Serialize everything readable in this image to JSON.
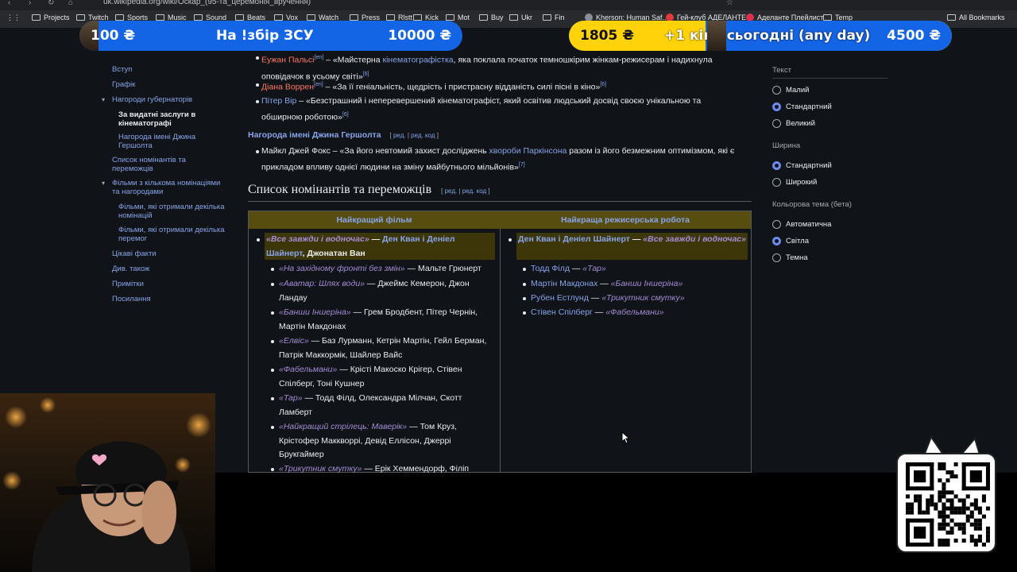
{
  "browser": {
    "url": "uk.wikipedia.org/wiki/Оскар_(95-та_церемонія_вручення)",
    "bookmarks": [
      {
        "label": "Projects",
        "type": "folder"
      },
      {
        "label": "Twitch",
        "type": "folder"
      },
      {
        "label": "Sports",
        "type": "folder"
      },
      {
        "label": "Music",
        "type": "folder"
      },
      {
        "label": "Sound",
        "type": "folder"
      },
      {
        "label": "Beats",
        "type": "folder"
      },
      {
        "label": "Vox",
        "type": "folder"
      },
      {
        "label": "Watch",
        "type": "folder"
      },
      {
        "label": "Press",
        "type": "folder"
      },
      {
        "label": "Rlstt",
        "type": "folder"
      },
      {
        "label": "Kick",
        "type": "folder"
      },
      {
        "label": "Mot",
        "type": "folder"
      },
      {
        "label": "Buy",
        "type": "folder"
      },
      {
        "label": "Ukr",
        "type": "folder"
      },
      {
        "label": "Fin",
        "type": "folder"
      },
      {
        "label": "Kherson: Human Saf...",
        "type": "site"
      },
      {
        "label": "Гей-клуб АДЕЛАНТЕ",
        "type": "site"
      },
      {
        "label": "Аделанте Плейлист",
        "type": "site"
      },
      {
        "label": "Temp",
        "type": "folder"
      }
    ],
    "all_bookmarks": "All Bookmarks"
  },
  "overlay": {
    "banner_left": {
      "left": "100 ₴",
      "center": "На !збір ЗСУ",
      "right": "10000 ₴"
    },
    "banner_right": {
      "left": "1805 ₴",
      "center": "+1 кіно сьогодні (any day)",
      "right": "4500 ₴"
    },
    "accent_blue": "#1464e6",
    "accent_yellow": "#ffd20a"
  },
  "toc": {
    "items": [
      {
        "label": "Вступ",
        "level": 1
      },
      {
        "label": "Графік",
        "level": 1
      },
      {
        "label": "Нагороди губернаторів",
        "level": 1,
        "expanded": true
      },
      {
        "label": "За видатні заслуги в кінематографі",
        "level": 2,
        "active": true
      },
      {
        "label": "Нагорода імені Джина Гершолта",
        "level": 2
      },
      {
        "label": "Список номінантів та переможців",
        "level": 1
      },
      {
        "label": "Фільми з кількома номінаціями та нагородами",
        "level": 1,
        "expanded": true
      },
      {
        "label": "Фільми, які отримали декілька номінацій",
        "level": 2
      },
      {
        "label": "Фільми, які отримали декілька перемог",
        "level": 2
      },
      {
        "label": "Цікаві факти",
        "level": 1
      },
      {
        "label": "Див. також",
        "level": 1
      },
      {
        "label": "Примітки",
        "level": 1
      },
      {
        "label": "Посилання",
        "level": 1
      }
    ]
  },
  "article": {
    "honorees": [
      {
        "name": "Еужан Пальсі",
        "sup": "[en]",
        "quote": " – «Майстерна ",
        "link": "кінематографістка",
        "rest": ", яка поклала початок темношкірим жінкам-режисерам і надихнула оповідачок в усьому світі»",
        "ref": "[6]"
      },
      {
        "name": "Діана Воррен",
        "sup": "[en]",
        "quote": " – «За її геніальність, щедрість і пристрасну відданість силі пісні в кіно»",
        "ref": "[6]"
      },
      {
        "name": "Пітер Вір",
        "quote": " – «Безстрашний і неперевершений кінематографіст, який освітив людський досвід своєю унікальною та обширною роботою»",
        "ref": "[6]"
      }
    ],
    "hersholt_heading": "Нагорода імені Джина Гершолта",
    "edit_links": {
      "open": "[",
      "edit": "ред.",
      "sep": "|",
      "edit_code": "ред. код",
      "close": "]"
    },
    "hersholt": {
      "text1": "Майкл Джей Фокс – «За його невтомий захист досліджень ",
      "link": "хвороби Паркінсона",
      "text2": " разом із його безмежним оптимізмом, які є прикладом впливу однієї людини на зміну майбутнього мільйонів»",
      "ref": "[7]"
    },
    "nominees_heading": "Список номінантів та переможців"
  },
  "table": {
    "headers": [
      "Найкращий фільм",
      "Найкраща режисерська робота"
    ],
    "best_picture_winner": {
      "film": "«Все завжди і водночас»",
      "dash": " — ",
      "people_link": "Ден Кван і Деніел Шайнерт",
      "people_plain": ", Джонатан Ван"
    },
    "best_picture_nominees": [
      {
        "film": "«На західному фронті без змін»",
        "dash": " — ",
        "people": "Мальте Грюнерт"
      },
      {
        "film": "«Аватар: Шлях води»",
        "dash": " — ",
        "people": "Джеймс Кемерон, Джон Ландау"
      },
      {
        "film": "«Банши Іншеріна»",
        "dash": " — ",
        "people": "Грем Бродбент, Пітер Чернін, Мартін Макдонах"
      },
      {
        "film": "«Елвіс»",
        "dash": " — ",
        "people": "Баз Лурманн, Кетрін Мартін, Гейл Берман, Патрік Маккормік, Шайлер Вайс"
      },
      {
        "film": "«Фабельмани»",
        "dash": " — ",
        "people": "Крісті Макоско Крігер, Стівен Спілберг, Тоні Кушнер"
      },
      {
        "film": "«Тар»",
        "dash": " — ",
        "people": "Тодд Філд, Олександра Мілчан, Скотт Ламберт"
      },
      {
        "film": "«Найкращий стрілець: Маверік»",
        "dash": " — ",
        "people": "Том Круз, Крістофер Маккворрі, Девід Еллісон, Джеррі Брукгаймер"
      },
      {
        "film": "«Трикутник смутку»",
        "dash": " — ",
        "people": "Ерік Хеммендорф, Філіп"
      }
    ],
    "director_winner": {
      "people": "Ден Кван і Деніел Шайнерт",
      "dash": " — ",
      "film": "«Все завжди і водночас»"
    },
    "director_nominees": [
      {
        "people": "Тодд Філд",
        "dash": " — ",
        "film": "«Тар»"
      },
      {
        "people": "Мартін Макдонах",
        "dash": " — ",
        "film": "«Банши Іншеріна»"
      },
      {
        "people": "Рубен Естлунд",
        "dash": " — ",
        "film": "«Трикутник смутку»"
      },
      {
        "people": "Стівен Спілберг",
        "dash": " — ",
        "film": "«Фабельмани»"
      }
    ]
  },
  "appearance": {
    "text_label": "Текст",
    "text_options": [
      {
        "label": "Малий",
        "selected": false
      },
      {
        "label": "Стандартний",
        "selected": true
      },
      {
        "label": "Великий",
        "selected": false
      }
    ],
    "width_label": "Ширина",
    "width_options": [
      {
        "label": "Стандартний",
        "selected": true
      },
      {
        "label": "Широкий",
        "selected": false
      }
    ],
    "theme_label": "Кольорова тема (бета)",
    "theme_options": [
      {
        "label": "Автоматична",
        "selected": false
      },
      {
        "label": "Світла",
        "selected": true
      },
      {
        "label": "Темна",
        "selected": false
      }
    ]
  }
}
